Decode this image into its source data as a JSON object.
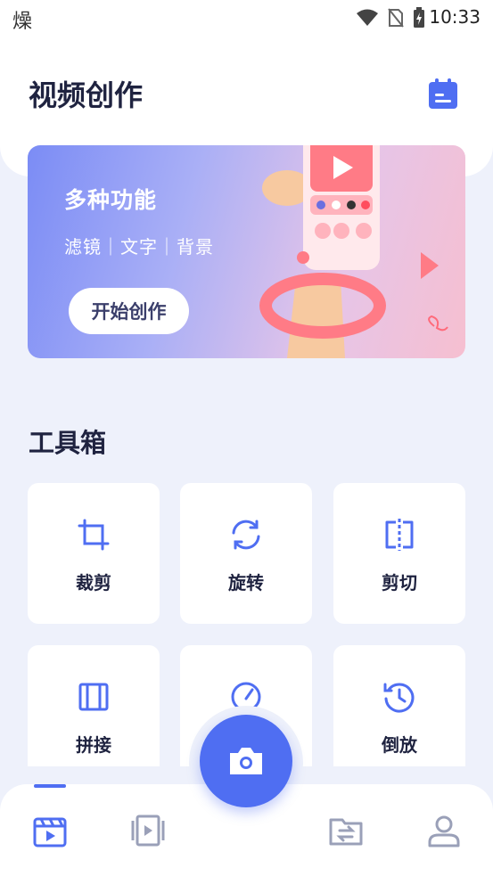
{
  "status_bar": {
    "left_glyph": "燥",
    "time": "10:33"
  },
  "header": {
    "title": "视频创作",
    "calendar_icon": "calendar-icon"
  },
  "banner": {
    "title": "多种功能",
    "subtitle": "滤镜｜文字｜背景",
    "button_label": "开始创作"
  },
  "toolbox": {
    "title": "工具箱",
    "items": [
      {
        "label": "裁剪",
        "icon": "crop-icon"
      },
      {
        "label": "旋转",
        "icon": "rotate-icon"
      },
      {
        "label": "剪切",
        "icon": "split-icon"
      },
      {
        "label": "拼接",
        "icon": "join-icon"
      },
      {
        "label": "",
        "icon": "speed-icon"
      },
      {
        "label": "倒放",
        "icon": "reverse-icon"
      }
    ]
  },
  "nav": {
    "items": [
      {
        "name": "video",
        "icon": "clapper-icon",
        "active": true
      },
      {
        "name": "clips",
        "icon": "clips-icon",
        "active": false
      },
      {
        "name": "convert",
        "icon": "folder-convert-icon",
        "active": false
      },
      {
        "name": "profile",
        "icon": "user-icon",
        "active": false
      }
    ],
    "fab_icon": "camera-icon"
  },
  "colors": {
    "accent": "#4f6ef2",
    "background": "#eef1fb",
    "text": "#1f2340"
  }
}
